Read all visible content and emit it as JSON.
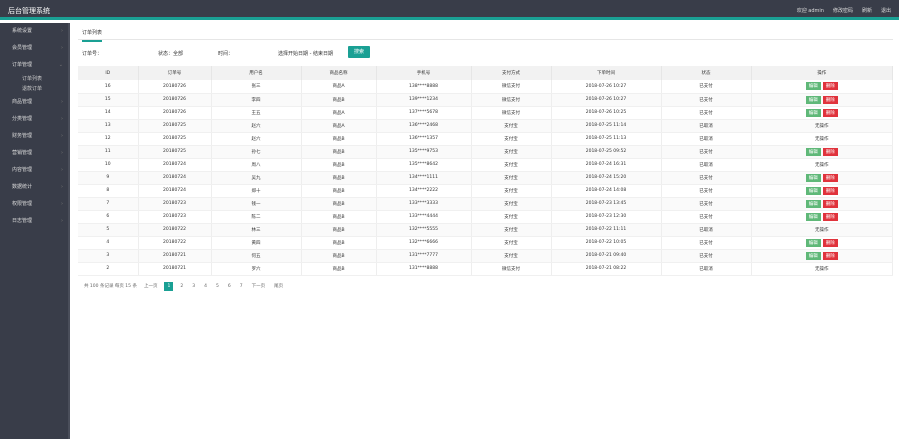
{
  "header": {
    "title": "后台管理系统",
    "nav": [
      "欢迎 admin",
      "修改密码",
      "刷新",
      "退出"
    ]
  },
  "sidebar": {
    "items": [
      "系统设置",
      "会员管理",
      "订单管理",
      "商品管理",
      "分类管理",
      "财务管理",
      "营销管理",
      "内容管理",
      "数据统计",
      "权限管理",
      "日志管理"
    ],
    "subitems": [
      "订单列表",
      "退款订单"
    ]
  },
  "tab": "订单列表",
  "filters": {
    "f1": "订单号：",
    "f2": "状态：全部",
    "f3": "时间：",
    "f4": "选择开始日期 - 结束日期",
    "search": "搜索"
  },
  "columns": [
    "ID",
    "订单号",
    "用户名",
    "商品名称",
    "手机号",
    "支付方式",
    "下单时间",
    "状态",
    "操作"
  ],
  "actions": {
    "edit": "编辑",
    "delete": "删除",
    "none": "无操作"
  },
  "rows": [
    {
      "id": "16",
      "no": "20180726",
      "user": "张三",
      "goods": "商品A",
      "phone": "138****8888",
      "pay": "微信支付",
      "time": "2018-07-26 10:27",
      "status": "已支付",
      "act": true
    },
    {
      "id": "15",
      "no": "20180726",
      "user": "李四",
      "goods": "商品B",
      "phone": "139****1234",
      "pay": "微信支付",
      "time": "2018-07-26 10:27",
      "status": "已支付",
      "act": true
    },
    {
      "id": "14",
      "no": "20180726",
      "user": "王五",
      "goods": "商品A",
      "phone": "137****5678",
      "pay": "微信支付",
      "time": "2018-07-26 10:25",
      "status": "已支付",
      "act": true
    },
    {
      "id": "13",
      "no": "20180725",
      "user": "赵六",
      "goods": "商品A",
      "phone": "136****2468",
      "pay": "支付宝",
      "time": "2018-07-25 11:14",
      "status": "已取消",
      "act": false
    },
    {
      "id": "12",
      "no": "20180725",
      "user": "赵六",
      "goods": "商品B",
      "phone": "136****1357",
      "pay": "支付宝",
      "time": "2018-07-25 11:13",
      "status": "已取消",
      "act": false
    },
    {
      "id": "11",
      "no": "20180725",
      "user": "孙七",
      "goods": "商品B",
      "phone": "135****9753",
      "pay": "支付宝",
      "time": "2018-07-25 09:52",
      "status": "已支付",
      "act": true
    },
    {
      "id": "10",
      "no": "20180724",
      "user": "周八",
      "goods": "商品B",
      "phone": "135****8642",
      "pay": "支付宝",
      "time": "2018-07-24 16:31",
      "status": "已取消",
      "act": false
    },
    {
      "id": "9",
      "no": "20180724",
      "user": "吴九",
      "goods": "商品B",
      "phone": "134****1111",
      "pay": "支付宝",
      "time": "2018-07-24 15:20",
      "status": "已支付",
      "act": true
    },
    {
      "id": "8",
      "no": "20180724",
      "user": "郑十",
      "goods": "商品B",
      "phone": "134****2222",
      "pay": "支付宝",
      "time": "2018-07-24 14:08",
      "status": "已支付",
      "act": true
    },
    {
      "id": "7",
      "no": "20180723",
      "user": "钱一",
      "goods": "商品B",
      "phone": "133****3333",
      "pay": "支付宝",
      "time": "2018-07-23 13:45",
      "status": "已支付",
      "act": true
    },
    {
      "id": "6",
      "no": "20180723",
      "user": "陈二",
      "goods": "商品B",
      "phone": "133****4444",
      "pay": "支付宝",
      "time": "2018-07-23 12:30",
      "status": "已支付",
      "act": true
    },
    {
      "id": "5",
      "no": "20180722",
      "user": "林三",
      "goods": "商品B",
      "phone": "132****5555",
      "pay": "支付宝",
      "time": "2018-07-22 11:11",
      "status": "已取消",
      "act": false
    },
    {
      "id": "4",
      "no": "20180722",
      "user": "黄四",
      "goods": "商品B",
      "phone": "132****6666",
      "pay": "支付宝",
      "time": "2018-07-22 10:05",
      "status": "已支付",
      "act": true
    },
    {
      "id": "3",
      "no": "20180721",
      "user": "何五",
      "goods": "商品B",
      "phone": "131****7777",
      "pay": "支付宝",
      "time": "2018-07-21 09:40",
      "status": "已支付",
      "act": true
    },
    {
      "id": "2",
      "no": "20180721",
      "user": "罗六",
      "goods": "商品B",
      "phone": "131****8888",
      "pay": "微信支付",
      "time": "2018-07-21 08:22",
      "status": "已取消",
      "act": false
    }
  ],
  "pager": {
    "info": "共 100 条记录 每页 15 条",
    "prev": "上一页",
    "pages": [
      "1",
      "2",
      "3",
      "4",
      "5",
      "6",
      "7"
    ],
    "current": "1",
    "next": "下一页",
    "last": "尾页"
  }
}
